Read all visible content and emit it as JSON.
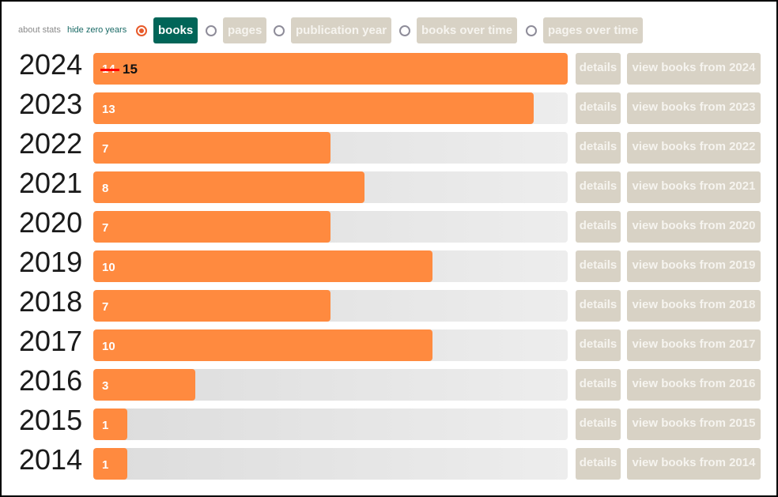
{
  "header": {
    "about_label": "about stats",
    "hide_zero_label": "hide zero years",
    "options": [
      {
        "label": "books",
        "selected": true
      },
      {
        "label": "pages",
        "selected": false
      },
      {
        "label": "publication year",
        "selected": false
      },
      {
        "label": "books over time",
        "selected": false
      },
      {
        "label": "pages over time",
        "selected": false
      }
    ]
  },
  "colors": {
    "bar": "#ff8a3f",
    "active_tab": "#016558",
    "inactive_tab": "#d8d2c5",
    "radio_selected": "#e85a2a",
    "strike": "#ff0000"
  },
  "buttons": {
    "details_label": "details"
  },
  "chart_data": {
    "type": "bar",
    "orientation": "horizontal",
    "title": "",
    "xlabel": "",
    "ylabel": "",
    "scale_max": 14,
    "categories": [
      "2024",
      "2023",
      "2022",
      "2021",
      "2020",
      "2019",
      "2018",
      "2017",
      "2016",
      "2015",
      "2014"
    ],
    "values": [
      15,
      13,
      7,
      8,
      7,
      10,
      7,
      10,
      3,
      1,
      1
    ],
    "annotations": [
      {
        "category": "2024",
        "previous_value": "14",
        "current_value": "15",
        "note": "previous value struck through"
      }
    ],
    "rows": [
      {
        "year": "2024",
        "label": "15",
        "old_label": "14",
        "view_label": "view books from 2024"
      },
      {
        "year": "2023",
        "label": "13",
        "view_label": "view books from 2023"
      },
      {
        "year": "2022",
        "label": "7",
        "view_label": "view books from 2022"
      },
      {
        "year": "2021",
        "label": "8",
        "view_label": "view books from 2021"
      },
      {
        "year": "2020",
        "label": "7",
        "view_label": "view books from 2020"
      },
      {
        "year": "2019",
        "label": "10",
        "view_label": "view books from 2019"
      },
      {
        "year": "2018",
        "label": "7",
        "view_label": "view books from 2018"
      },
      {
        "year": "2017",
        "label": "10",
        "view_label": "view books from 2017"
      },
      {
        "year": "2016",
        "label": "3",
        "view_label": "view books from 2016"
      },
      {
        "year": "2015",
        "label": "1",
        "view_label": "view books from 2015"
      },
      {
        "year": "2014",
        "label": "1",
        "view_label": "view books from 2014"
      }
    ]
  }
}
